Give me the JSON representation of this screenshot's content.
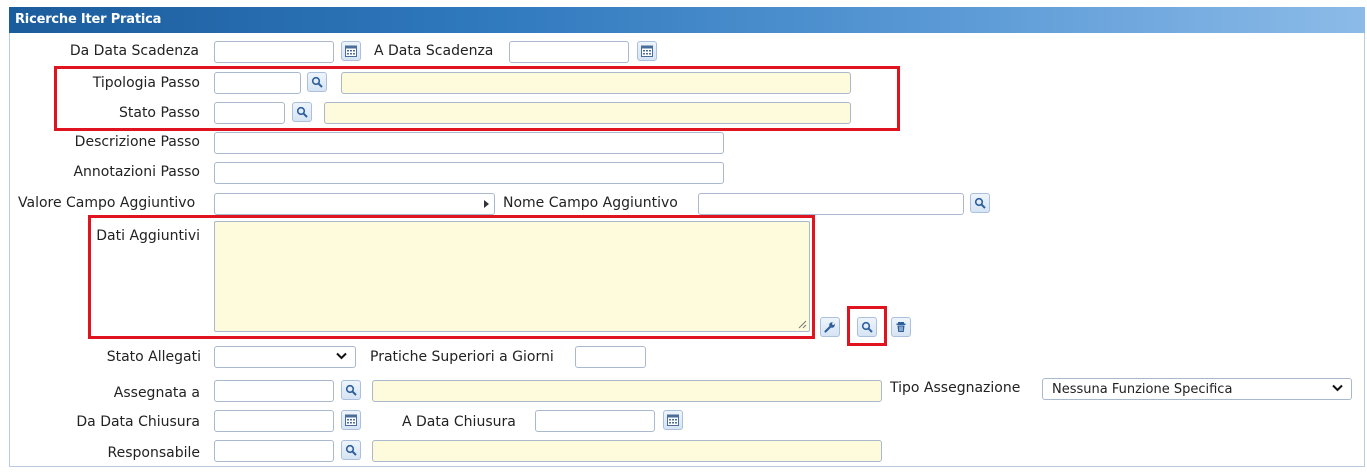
{
  "header": {
    "title": "Ricerche Iter Pratica"
  },
  "fields": {
    "da_data_scadenza": "Da Data Scadenza",
    "a_data_scadenza": "A Data Scadenza",
    "tipologia_passo": "Tipologia Passo",
    "stato_passo": "Stato Passo",
    "descrizione_passo": "Descrizione Passo",
    "annotazioni_passo": "Annotazioni Passo",
    "valore_campo_aggiuntivo": "Valore Campo Aggiuntivo",
    "nome_campo_aggiuntivo": "Nome Campo Aggiuntivo",
    "dati_aggiuntivi": "Dati Aggiuntivi",
    "stato_allegati": "Stato Allegati",
    "pratiche_superiori": "Pratiche Superiori a Giorni",
    "assegnata_a": "Assegnata a",
    "tipo_assegnazione": "Tipo Assegnazione",
    "tipo_assegnazione_value": "Nessuna Funzione Specifica",
    "da_data_chiusura": "Da Data Chiusura",
    "a_data_chiusura": "A Data Chiusura",
    "responsabile": "Responsabile"
  },
  "icons": {
    "calendar": "calendar-icon",
    "search": "search-icon",
    "wrench": "wrench-icon",
    "trash": "trash-icon",
    "chevron": "chevron-down-icon"
  },
  "colors": {
    "title_bar": "#2f79bd",
    "highlight": "#e0141e",
    "readonly_field": "#fdfbdc",
    "button_bg": "#dde9f6"
  }
}
